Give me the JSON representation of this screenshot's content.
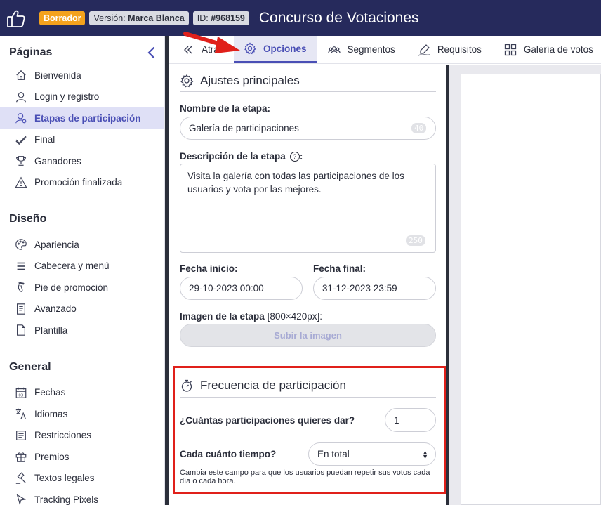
{
  "header": {
    "badge_draft": "Borrador",
    "version_label": "Versión:",
    "version_value": "Marca Blanca",
    "id_label": "ID:",
    "id_value": "#968159",
    "title": "Concurso de Votaciones"
  },
  "sidebar": {
    "sections": {
      "pages": {
        "title": "Páginas",
        "items": [
          "Bienvenida",
          "Login y registro",
          "Etapas de participación",
          "Final",
          "Ganadores",
          "Promoción finalizada"
        ]
      },
      "design": {
        "title": "Diseño",
        "items": [
          "Apariencia",
          "Cabecera y menú",
          "Pie de promoción",
          "Avanzado",
          "Plantilla"
        ]
      },
      "general": {
        "title": "General",
        "items": [
          "Fechas",
          "Idiomas",
          "Restricciones",
          "Premios",
          "Textos legales",
          "Tracking Pixels"
        ]
      }
    },
    "active_item": "Etapas de participación"
  },
  "tabs": {
    "back": "Atrás",
    "options": "Opciones",
    "segments": "Segmentos",
    "requirements": "Requisitos",
    "gallery": "Galería de votos"
  },
  "main_settings": {
    "title": "Ajustes principales",
    "stage_name_label": "Nombre de la etapa:",
    "stage_name_value": "Galería de participaciones",
    "stage_name_counter": "40",
    "description_label": "Descripción de la etapa",
    "description_colon": ":",
    "description_help": "?",
    "description_value": "Visita la galería con todas las participaciones de los usuarios y vota por las mejores.",
    "description_counter": "250",
    "start_label": "Fecha inicio:",
    "start_value": "29-10-2023 00:00",
    "end_label": "Fecha final:",
    "end_value": "31-12-2023 23:59",
    "image_label": "Imagen de la etapa",
    "image_size": "[800×420px]:",
    "upload_button": "Subir la imagen"
  },
  "frequency": {
    "title": "Frecuencia de participación",
    "count_label": "¿Cuántas participaciones quieres dar?",
    "count_value": "1",
    "interval_label": "Cada cuánto tiempo?",
    "interval_value": "En total",
    "hint": "Cambia este campo para que los usuarios puedan repetir sus votos cada día o cada hora."
  },
  "colors": {
    "header_bg": "#262a5c",
    "accent": "#4a4fb5",
    "draft_badge": "#f4a21d",
    "highlight": "#e0201a"
  }
}
